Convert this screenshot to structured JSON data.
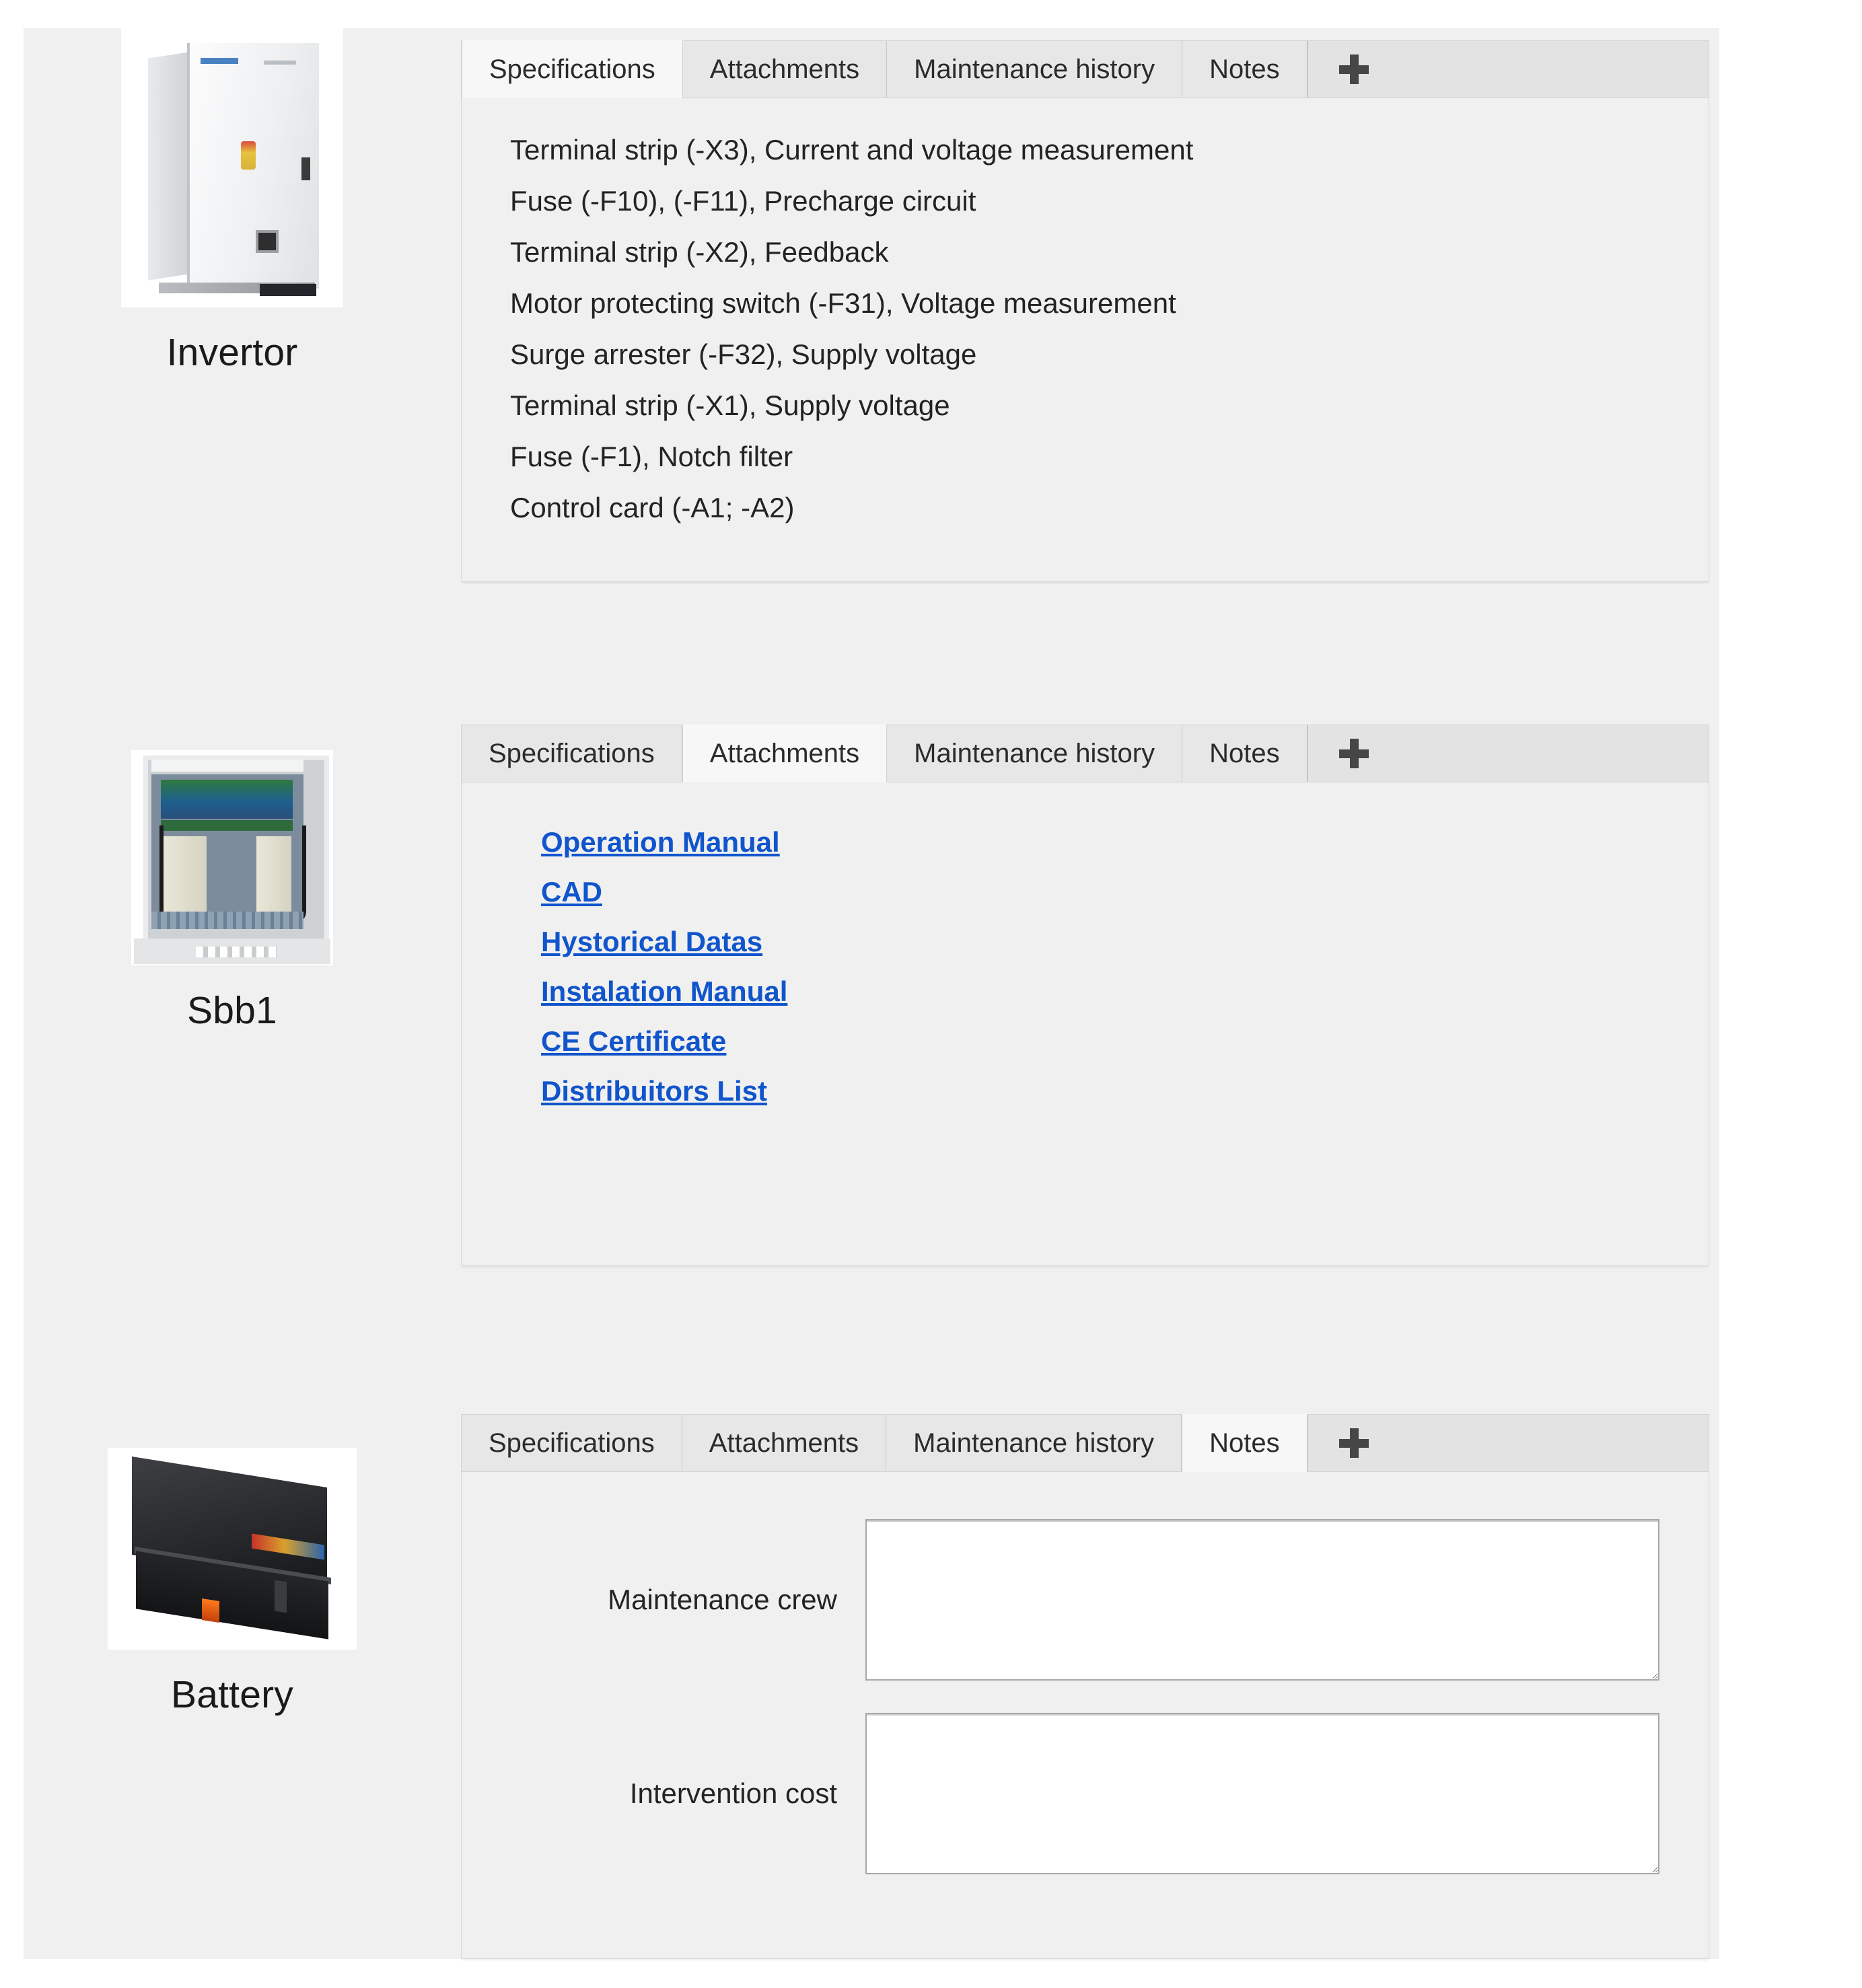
{
  "tabs": {
    "specifications": "Specifications",
    "attachments": "Attachments",
    "maintenance_history": "Maintenance history",
    "notes": "Notes",
    "add_tab_icon": "plus-icon"
  },
  "colors": {
    "canvas": "#f0f0f0",
    "tab_inactive": "#e7e7e7",
    "tab_active": "#f7f7f7",
    "link": "#1155cc",
    "text": "#232323"
  },
  "cards": [
    {
      "name": "Invertor",
      "thumbnail_icon": "inverter-cabinet-photo",
      "active_tab": "Specifications",
      "specifications": [
        "Terminal strip (-X3), Current and voltage measurement",
        "Fuse (-F10), (-F11), Precharge circuit",
        "Terminal strip (-X2), Feedback",
        "Motor protecting switch (-F31), Voltage measurement",
        "Surge arrester (-F32), Supply voltage",
        "Terminal strip (-X1), Supply voltage",
        "Fuse (-F1), Notch filter",
        "Control card (-A1; -A2)"
      ]
    },
    {
      "name": "Sbb1",
      "thumbnail_icon": "control-panel-photo",
      "active_tab": "Attachments",
      "attachments": [
        "Operation Manual",
        "CAD",
        "Hystorical Datas",
        "Instalation Manual",
        "CE Certificate",
        "Distribuitors List"
      ]
    },
    {
      "name": "Battery",
      "thumbnail_icon": "battery-unit-photo",
      "active_tab": "Notes",
      "notes_fields": [
        {
          "label": "Maintenance crew",
          "value": ""
        },
        {
          "label": "Intervention cost",
          "value": ""
        }
      ]
    }
  ]
}
